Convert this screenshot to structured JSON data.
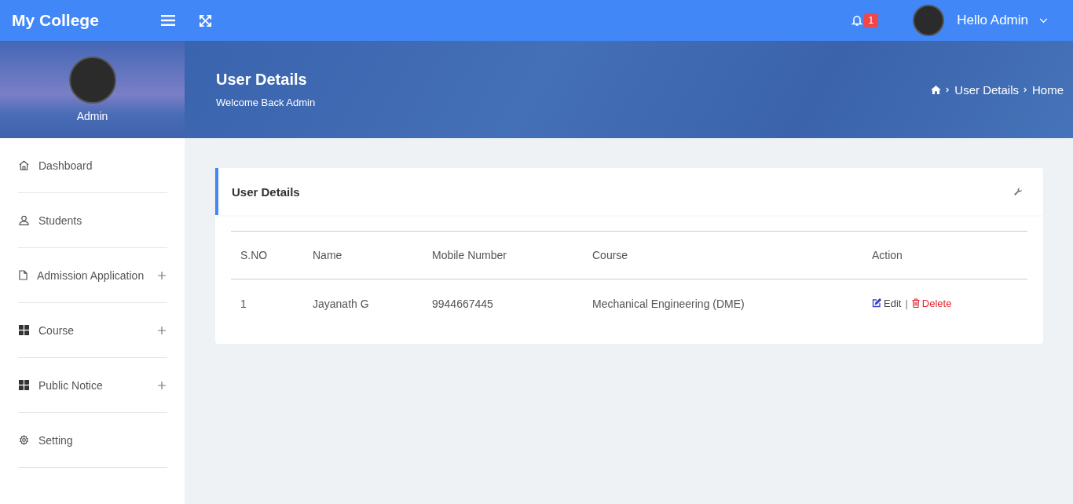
{
  "topbar": {
    "brand": "My College",
    "notification_count": "1",
    "user_greeting": "Hello Admin"
  },
  "profile": {
    "name": "Admin"
  },
  "page_header": {
    "title": "User Details",
    "subtitle": "Welcome Back Admin",
    "breadcrumb": [
      "User Details",
      "Home"
    ]
  },
  "sidebar": {
    "items": [
      {
        "label": "Dashboard",
        "kind": "home",
        "expandable": false
      },
      {
        "label": "Students",
        "kind": "user",
        "expandable": false
      },
      {
        "label": "Admission Application",
        "kind": "file",
        "expandable": true
      },
      {
        "label": "Course",
        "kind": "grid",
        "expandable": true
      },
      {
        "label": "Public Notice",
        "kind": "grid",
        "expandable": true
      },
      {
        "label": "Setting",
        "kind": "gear",
        "expandable": false
      }
    ]
  },
  "card": {
    "title": "User Details",
    "table": {
      "columns": [
        "S.NO",
        "Name",
        "Mobile Number",
        "Course",
        "Action"
      ],
      "rows": [
        {
          "cells": [
            "1",
            "Jayanath G",
            "9944667445",
            "Mechanical Engineering (DME)"
          ],
          "edit": "Edit",
          "separator": "|",
          "delete": "Delete"
        }
      ]
    }
  }
}
